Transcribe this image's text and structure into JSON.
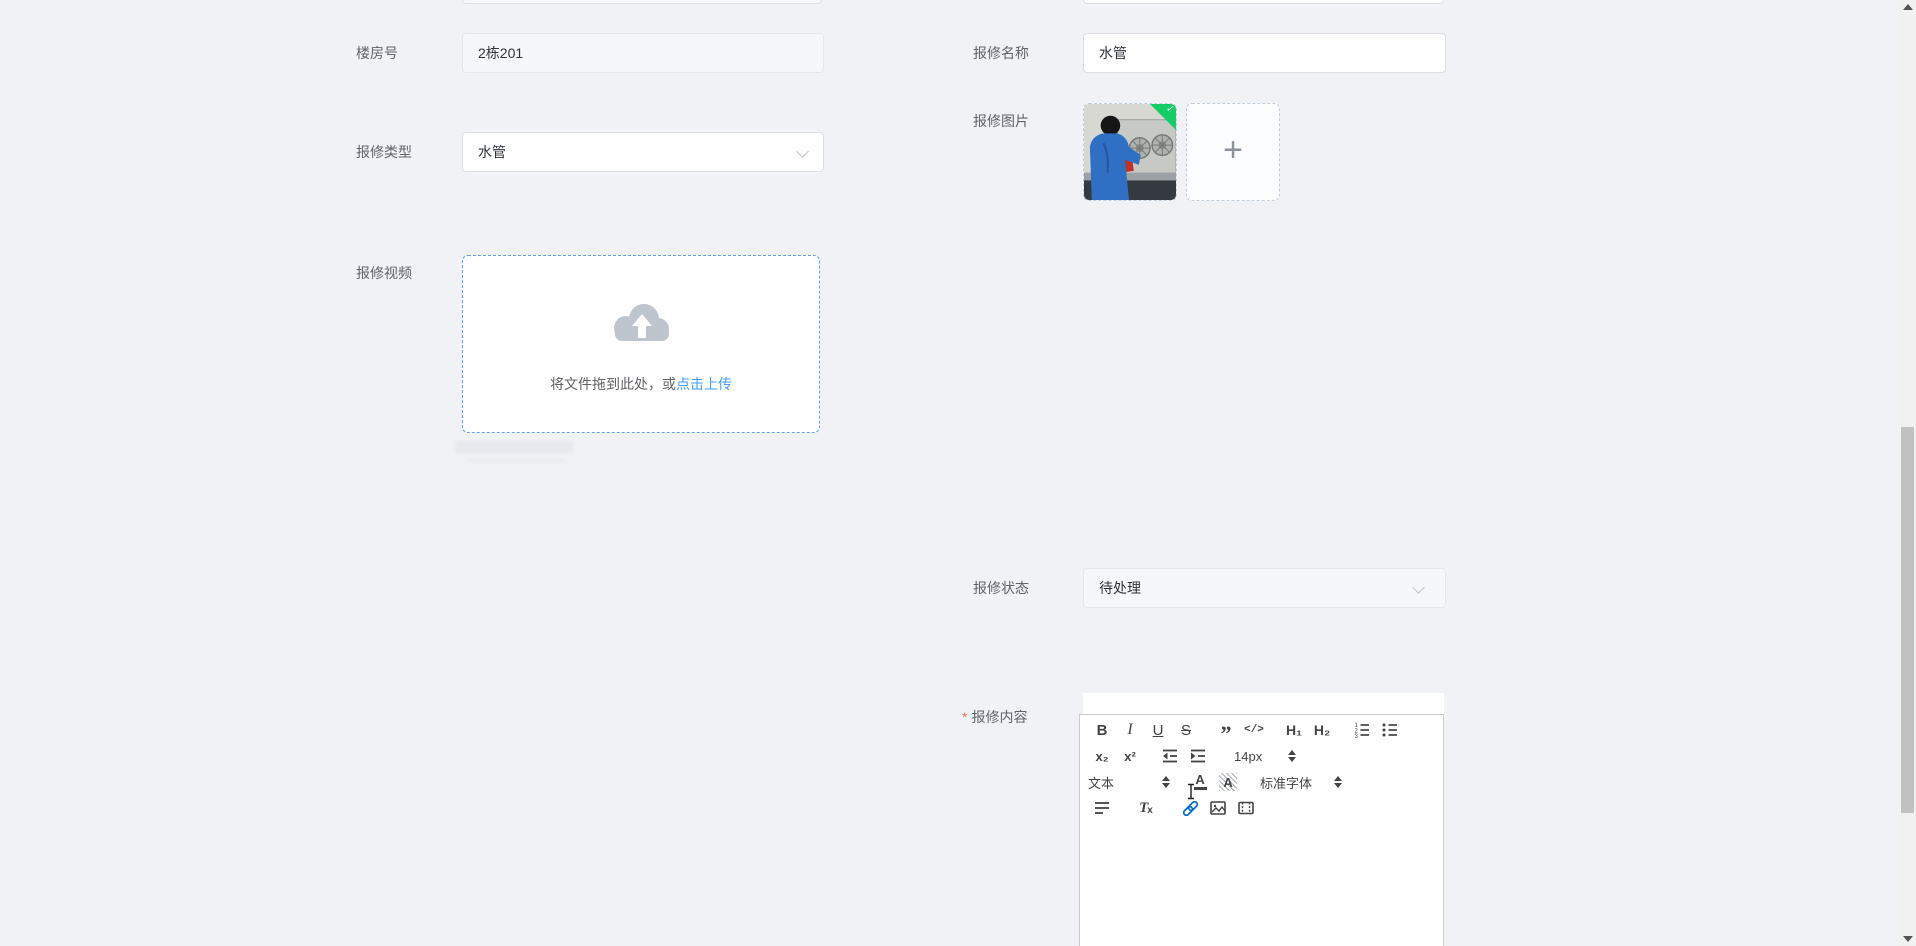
{
  "page": {
    "background": "#f0f2f5"
  },
  "icons": {
    "plus": "+",
    "check": "✓"
  },
  "fields": {
    "building": {
      "label": "楼房号",
      "value": "2栋201"
    },
    "type": {
      "label": "报修类型",
      "value": "水管"
    },
    "video": {
      "label": "报修视频"
    },
    "name": {
      "label": "报修名称",
      "value": "水管"
    },
    "images": {
      "label": "报修图片"
    },
    "status": {
      "label": "报修状态",
      "value": "待处理"
    },
    "content": {
      "label": "报修内容",
      "required_mark": "*"
    }
  },
  "upload": {
    "drag_text": "将文件拖到此处，或",
    "click_text": "点击上传"
  },
  "toolbar": {
    "bold": "B",
    "italic": "I",
    "underline": "U",
    "strike": "S",
    "quote": "”",
    "code": "</>",
    "h1": "H₁",
    "h2": "H₂",
    "subscript": "x₂",
    "superscript": "x²",
    "size": "14px",
    "header": "文本",
    "color": "A",
    "background": "A",
    "font": "标准字体",
    "clean_t": "T",
    "clean_x": "x"
  },
  "colors": {
    "accent": "#409eff",
    "success": "#13ce66",
    "link_active": "#0066cc",
    "background": "#f0f2f5"
  }
}
